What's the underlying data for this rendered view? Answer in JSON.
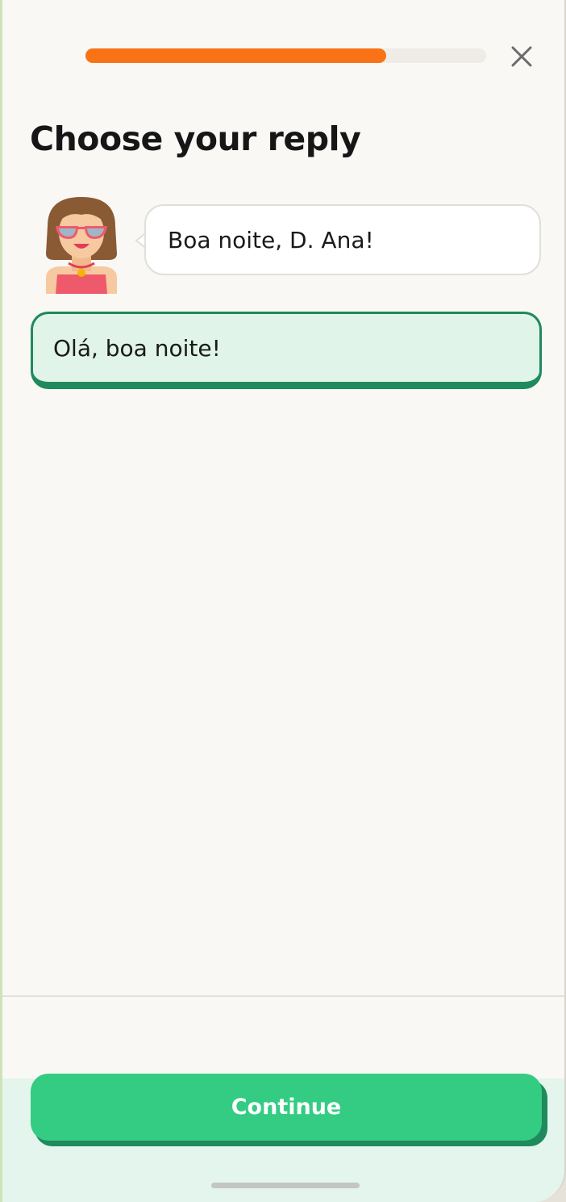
{
  "progress": {
    "value": 0.75,
    "color": "#f97316"
  },
  "header": {
    "close_icon": "close-icon"
  },
  "title": "Choose your reply",
  "conversation": {
    "speaker_avatar": "woman-with-sunglasses-avatar",
    "message": "Boa noite, D. Ana!"
  },
  "reply_option": {
    "label": "Olá, boa noite!",
    "selected": true,
    "accent": "#1f8a5b"
  },
  "footer": {
    "continue_label": "Continue",
    "button_color": "#33cc82"
  }
}
